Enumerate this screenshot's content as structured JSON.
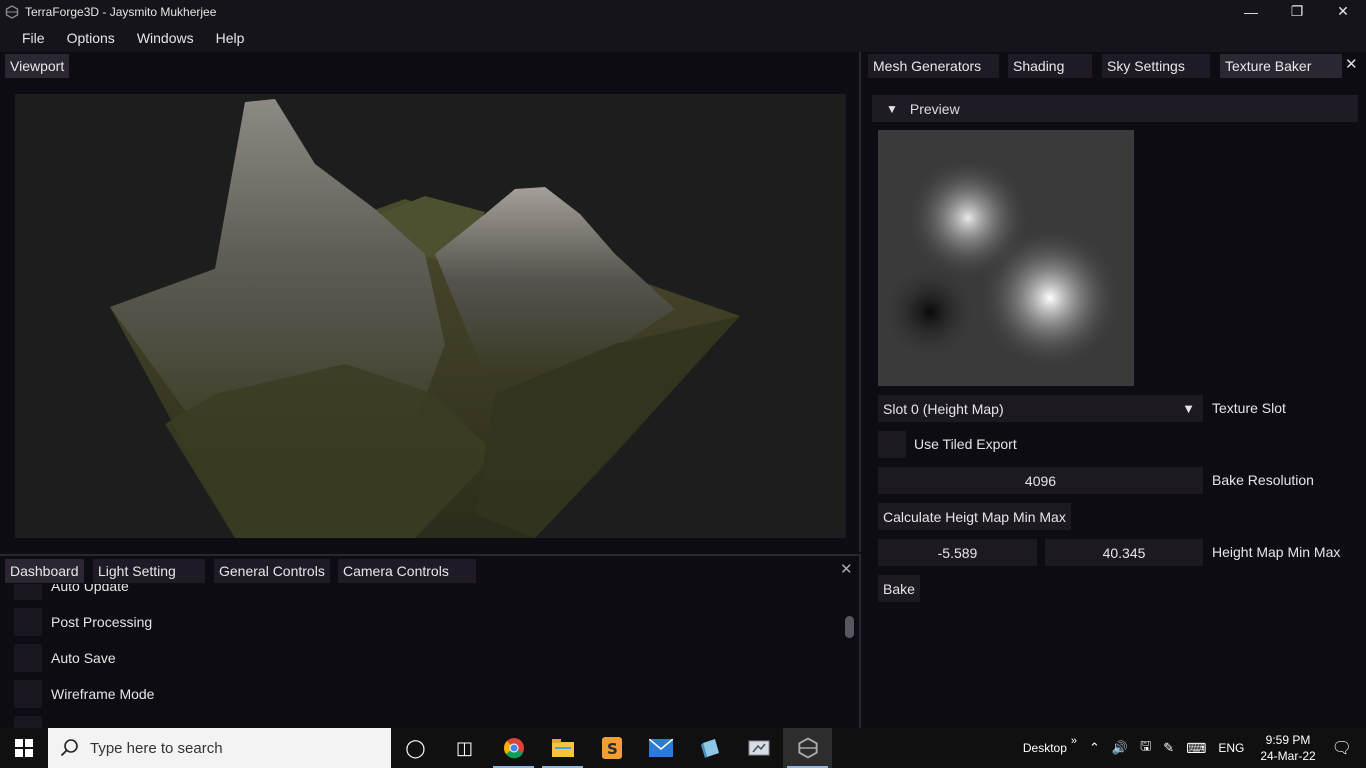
{
  "window": {
    "title": "TerraForge3D - Jaysmito Mukherjee"
  },
  "menu": [
    "File",
    "Options",
    "Windows",
    "Help"
  ],
  "viewport": {
    "tab": "Viewport"
  },
  "dashboard": {
    "tabs": [
      "Dashboard",
      "Light Setting",
      "General Controls",
      "Camera Controls"
    ],
    "options": [
      "Auto Update",
      "Post Processing",
      "Auto Save",
      "Wireframe Mode"
    ]
  },
  "right": {
    "tabs": [
      "Mesh Generators",
      "Shading",
      "Sky Settings",
      "Texture Baker"
    ],
    "section": "Preview",
    "slot_value": "Slot 0 (Height Map)",
    "slot_label": "Texture Slot",
    "tiled_label": "Use Tiled Export",
    "resolution_value": "4096",
    "resolution_label": "Bake Resolution",
    "calc_button": "Calculate Heigt Map Min Max",
    "min_value": "-5.589",
    "max_value": "40.345",
    "minmax_label": "Height Map Min Max",
    "bake_button": "Bake"
  },
  "taskbar": {
    "search_placeholder": "Type here to search",
    "desktop": "Desktop",
    "lang": "ENG",
    "time": "9:59 PM",
    "date": "24-Mar-22"
  }
}
